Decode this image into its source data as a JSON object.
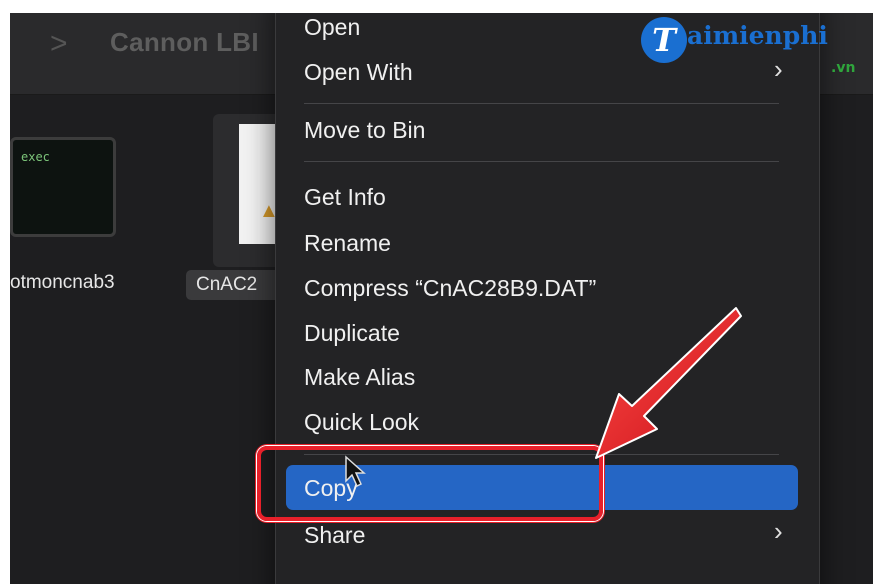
{
  "toolbar": {
    "separator": ">",
    "path_label": "Cannon LBI"
  },
  "files": [
    {
      "label": "otmoncnab3",
      "thumb_text": "exec"
    },
    {
      "label": "CnAC2",
      "thumb_icon": "warning-icon"
    }
  ],
  "context_menu": {
    "items": [
      {
        "label": "Open"
      },
      {
        "label": "Open With",
        "submenu_icon": "chevron-right-icon"
      },
      {
        "label": "Move to Bin"
      },
      {
        "label": "Get Info"
      },
      {
        "label": "Rename"
      },
      {
        "label": "Compress “CnAC28B9.DAT”"
      },
      {
        "label": "Duplicate"
      },
      {
        "label": "Make Alias"
      },
      {
        "label": "Quick Look"
      },
      {
        "label": "Copy",
        "highlighted": true
      },
      {
        "label": "Share",
        "submenu_icon": "chevron-right-icon"
      }
    ],
    "chevron": "›",
    "highlight_color": "#2566c5"
  },
  "annotation": {
    "box_color": "#e8202a",
    "arrow_color": "#e8202a"
  },
  "watermark": {
    "logo_letter": "T",
    "logo_text": "aimienphi",
    "logo_suffix": ".vn",
    "brand_color": "#1a6fd1"
  }
}
